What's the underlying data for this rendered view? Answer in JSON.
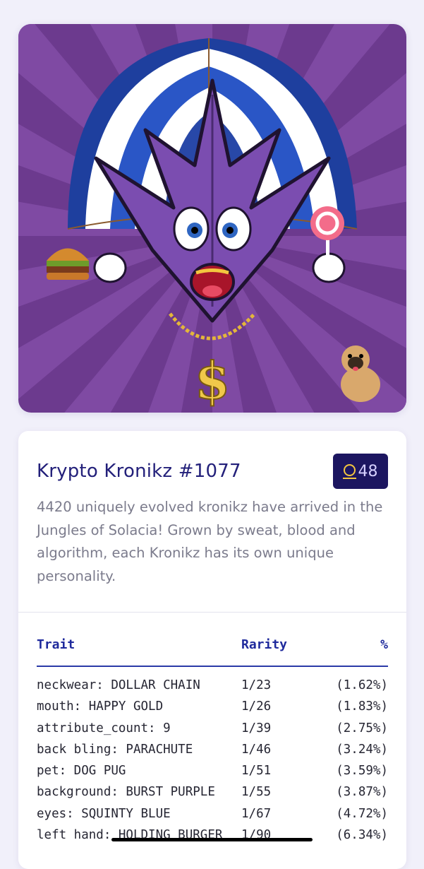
{
  "nft": {
    "image_alt": "Krypto Kronikz #1077 artwork",
    "title": "Krypto Kronikz #1077",
    "badge_value": "48",
    "badge_icon": "coin-icon",
    "description": "4420 uniquely evolved kronikz have arrived in the Jungles of Solacia! Grown by sweat, blood and algorithm, each Kronikz has its own unique personality."
  },
  "traits": {
    "headers": {
      "trait": "Trait",
      "rarity": "Rarity",
      "percent": "%"
    },
    "rows": [
      {
        "trait": "neckwear: DOLLAR CHAIN",
        "rarity": "1/23",
        "percent": "(1.62%)"
      },
      {
        "trait": "mouth: HAPPY GOLD",
        "rarity": "1/26",
        "percent": "(1.83%)"
      },
      {
        "trait": "attribute_count: 9",
        "rarity": "1/39",
        "percent": "(2.75%)"
      },
      {
        "trait": "back bling: PARACHUTE",
        "rarity": "1/46",
        "percent": "(3.24%)"
      },
      {
        "trait": "pet: DOG PUG",
        "rarity": "1/51",
        "percent": "(3.59%)"
      },
      {
        "trait": "background: BURST PURPLE",
        "rarity": "1/55",
        "percent": "(3.87%)"
      },
      {
        "trait": "eyes: SQUINTY BLUE",
        "rarity": "1/67",
        "percent": "(4.72%)"
      },
      {
        "trait": "left hand: HOLDING BURGER",
        "rarity": "1/90",
        "percent": "(6.34%)"
      }
    ]
  },
  "colors": {
    "page_bg": "#f1f0fa",
    "title": "#23207a",
    "badge_bg": "#1c1660",
    "table_header": "#1f2a9c",
    "art_bg": "#6c3a8e"
  }
}
